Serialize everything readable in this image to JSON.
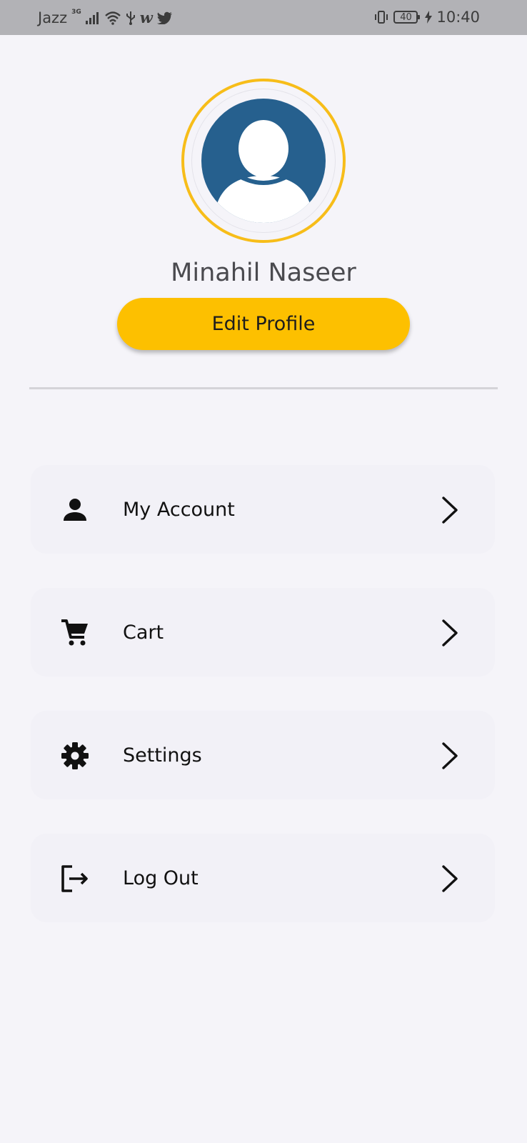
{
  "status_bar": {
    "carrier": "Jazz",
    "network": "3G",
    "battery": "40",
    "time": "10:40",
    "icons": [
      "signal-icon",
      "wifi-icon",
      "usb-icon",
      "w-app-icon",
      "twitter-icon",
      "vibrate-icon",
      "battery-icon",
      "charging-icon"
    ]
  },
  "profile": {
    "name": "Minahil Naseer",
    "edit_button_label": "Edit Profile"
  },
  "menu": {
    "items": [
      {
        "label": "My Account",
        "icon": "person-icon"
      },
      {
        "label": "Cart",
        "icon": "cart-icon"
      },
      {
        "label": "Settings",
        "icon": "gear-icon"
      },
      {
        "label": "Log Out",
        "icon": "logout-icon"
      }
    ]
  },
  "colors": {
    "accent": "#fdc000",
    "ring": "#f7bd19",
    "avatar_bg": "#26608e",
    "background": "#f5f4f9",
    "card": "#f2f1f7"
  }
}
